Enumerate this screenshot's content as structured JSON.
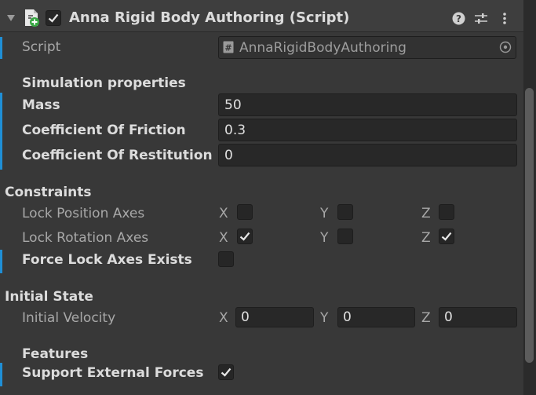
{
  "component": {
    "title": "Anna Rigid Body Authoring (Script)",
    "enabled": true,
    "icons": [
      "help-icon",
      "presets-icon",
      "kebab-menu-icon"
    ]
  },
  "script_field": {
    "label": "Script",
    "value": "AnnaRigidBodyAuthoring"
  },
  "simulation": {
    "header": "Simulation properties",
    "mass": {
      "label": "Mass",
      "value": "50"
    },
    "friction": {
      "label": "Coefficient Of Friction",
      "value": "0.3"
    },
    "restitution": {
      "label": "Coefficient Of Restitution",
      "value": "0"
    }
  },
  "constraints": {
    "header": "Constraints",
    "axes": [
      "X",
      "Y",
      "Z"
    ],
    "lock_position": {
      "label": "Lock Position Axes",
      "x": false,
      "y": false,
      "z": false
    },
    "lock_rotation": {
      "label": "Lock Rotation Axes",
      "x": true,
      "y": false,
      "z": true
    },
    "force_lock": {
      "label": "Force Lock Axes Exists",
      "checked": false
    }
  },
  "initial_state": {
    "header": "Initial State",
    "velocity": {
      "label": "Initial Velocity",
      "x": "0",
      "y": "0",
      "z": "0"
    }
  },
  "features": {
    "header": "Features",
    "external_forces": {
      "label": "Support External Forces",
      "checked": true
    }
  },
  "colors": {
    "background": "#383838",
    "header_background": "#3e3e3e",
    "field_background": "#282828",
    "override_bar": "#1f8fd6",
    "text": "#d2d2d2"
  }
}
